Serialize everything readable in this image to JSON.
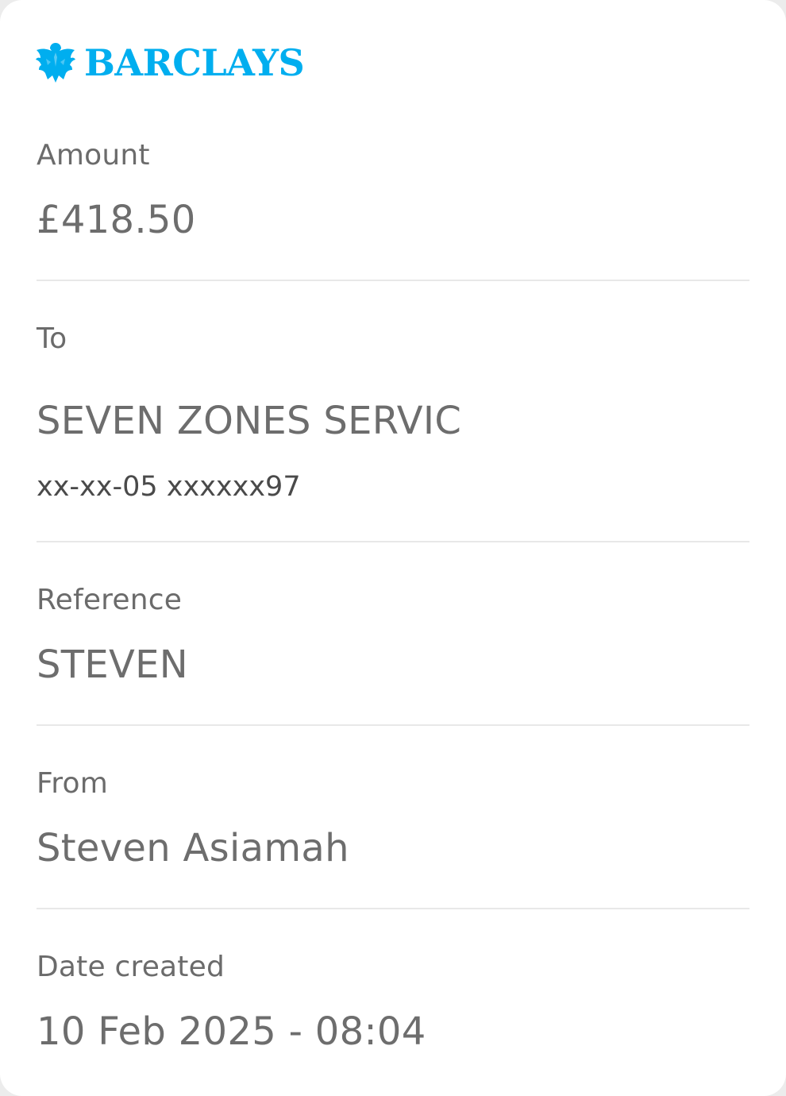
{
  "brand": {
    "logo_icon": "barclays-eagle-icon",
    "name": "BARCLAYS",
    "color": "#00AEEF"
  },
  "details": {
    "amount_label": "Amount",
    "amount_value": "£418.50",
    "to_label": "To",
    "to_value": "SEVEN ZONES SERVIC",
    "to_account": "xx-xx-05 xxxxxx97",
    "reference_label": "Reference",
    "reference_value": "STEVEN",
    "from_label": "From",
    "from_value": "Steven Asiamah",
    "date_label": "Date created",
    "date_value": "10 Feb 2025 - 08:04"
  }
}
